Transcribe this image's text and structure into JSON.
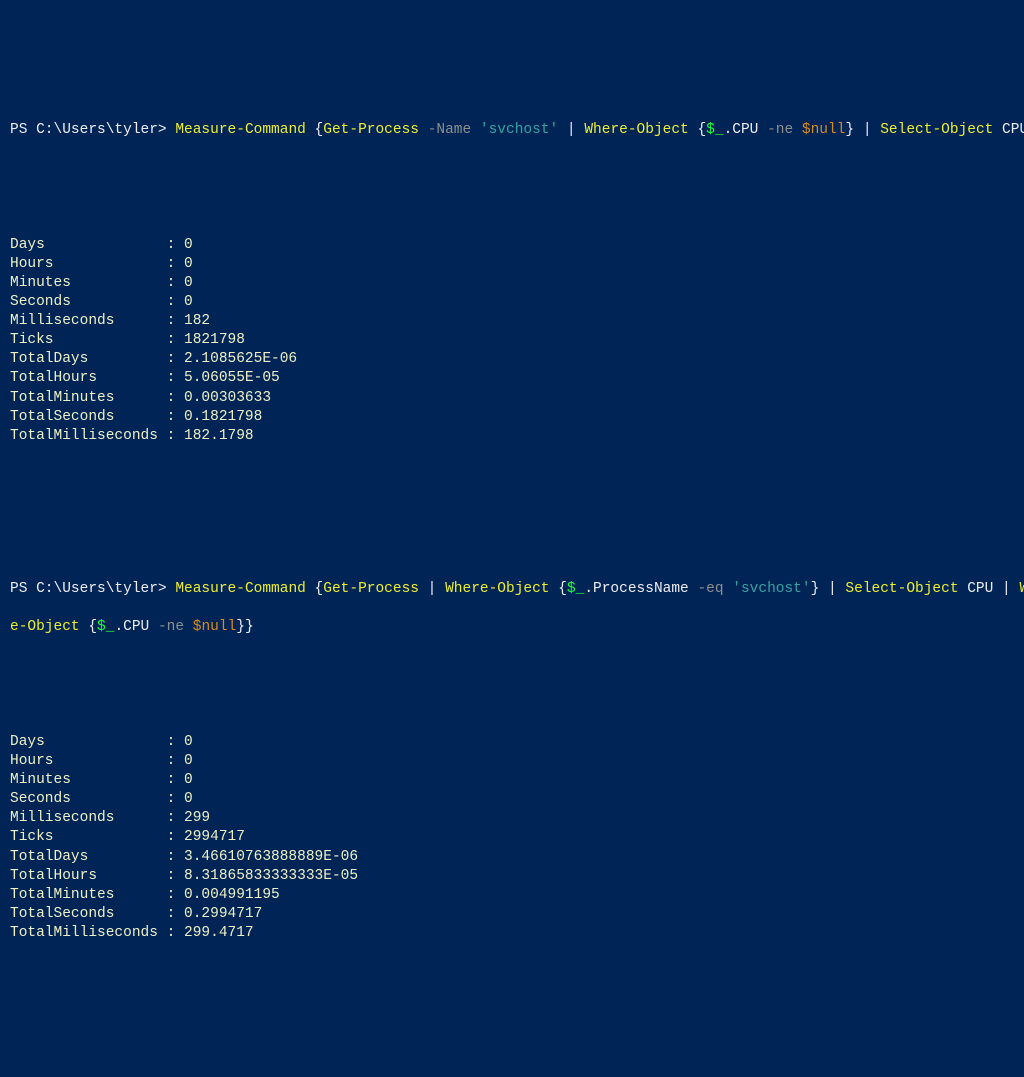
{
  "prompt": "PS C:\\Users\\tyler> ",
  "cmd1": {
    "tokens": [
      {
        "t": "Measure-Command",
        "c": "yellow"
      },
      {
        "t": " {",
        "c": "white"
      },
      {
        "t": "Get-Process",
        "c": "yellow"
      },
      {
        "t": " ",
        "c": "white"
      },
      {
        "t": "-Name",
        "c": "gray"
      },
      {
        "t": " ",
        "c": "white"
      },
      {
        "t": "'svchost'",
        "c": "teal"
      },
      {
        "t": " | ",
        "c": "white"
      },
      {
        "t": "Where-Object",
        "c": "yellow"
      },
      {
        "t": " {",
        "c": "white"
      },
      {
        "t": "$_",
        "c": "green"
      },
      {
        "t": ".CPU ",
        "c": "white"
      },
      {
        "t": "-ne",
        "c": "gray"
      },
      {
        "t": " ",
        "c": "white"
      },
      {
        "t": "$null",
        "c": "orange"
      },
      {
        "t": "} | ",
        "c": "white"
      },
      {
        "t": "Select-Object",
        "c": "yellow"
      },
      {
        "t": " CPU}",
        "c": "white"
      }
    ]
  },
  "out1": [
    {
      "k": "Days",
      "v": "0"
    },
    {
      "k": "Hours",
      "v": "0"
    },
    {
      "k": "Minutes",
      "v": "0"
    },
    {
      "k": "Seconds",
      "v": "0"
    },
    {
      "k": "Milliseconds",
      "v": "182"
    },
    {
      "k": "Ticks",
      "v": "1821798"
    },
    {
      "k": "TotalDays",
      "v": "2.1085625E-06"
    },
    {
      "k": "TotalHours",
      "v": "5.06055E-05"
    },
    {
      "k": "TotalMinutes",
      "v": "0.00303633"
    },
    {
      "k": "TotalSeconds",
      "v": "0.1821798"
    },
    {
      "k": "TotalMilliseconds",
      "v": "182.1798"
    }
  ],
  "cmd2": {
    "line1": [
      {
        "t": "Measure-Command",
        "c": "yellow"
      },
      {
        "t": " {",
        "c": "white"
      },
      {
        "t": "Get-Process",
        "c": "yellow"
      },
      {
        "t": " | ",
        "c": "white"
      },
      {
        "t": "Where-Object",
        "c": "yellow"
      },
      {
        "t": " {",
        "c": "white"
      },
      {
        "t": "$_",
        "c": "green"
      },
      {
        "t": ".ProcessName ",
        "c": "white"
      },
      {
        "t": "-eq",
        "c": "gray"
      },
      {
        "t": " ",
        "c": "white"
      },
      {
        "t": "'svchost'",
        "c": "teal"
      },
      {
        "t": "} | ",
        "c": "white"
      },
      {
        "t": "Select-Object",
        "c": "yellow"
      },
      {
        "t": " CPU | ",
        "c": "white"
      },
      {
        "t": "Wher",
        "c": "yellow"
      }
    ],
    "line2": [
      {
        "t": "e-Object",
        "c": "yellow"
      },
      {
        "t": " {",
        "c": "white"
      },
      {
        "t": "$_",
        "c": "green"
      },
      {
        "t": ".CPU ",
        "c": "white"
      },
      {
        "t": "-ne",
        "c": "gray"
      },
      {
        "t": " ",
        "c": "white"
      },
      {
        "t": "$null",
        "c": "orange"
      },
      {
        "t": "}}",
        "c": "white"
      }
    ]
  },
  "out2": [
    {
      "k": "Days",
      "v": "0"
    },
    {
      "k": "Hours",
      "v": "0"
    },
    {
      "k": "Minutes",
      "v": "0"
    },
    {
      "k": "Seconds",
      "v": "0"
    },
    {
      "k": "Milliseconds",
      "v": "299"
    },
    {
      "k": "Ticks",
      "v": "2994717"
    },
    {
      "k": "TotalDays",
      "v": "3.46610763888889E-06"
    },
    {
      "k": "TotalHours",
      "v": "8.31865833333333E-05"
    },
    {
      "k": "TotalMinutes",
      "v": "0.004991195"
    },
    {
      "k": "TotalSeconds",
      "v": "0.2994717"
    },
    {
      "k": "TotalMilliseconds",
      "v": "299.4717"
    }
  ],
  "colon": ": "
}
